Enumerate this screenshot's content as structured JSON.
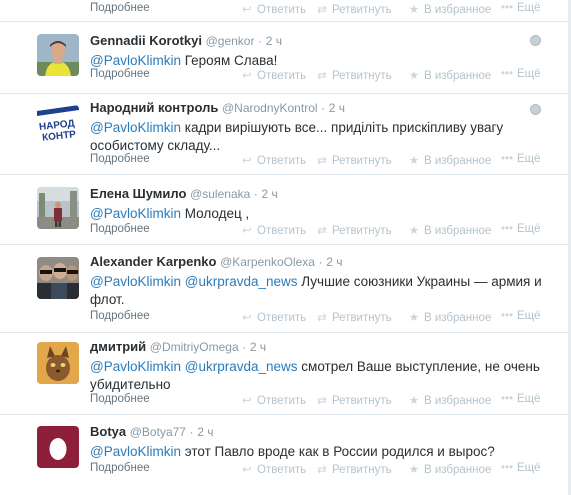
{
  "labels": {
    "details": "Подробнее",
    "reply": "Ответить",
    "retweet": "Ретвитнуть",
    "favorite": "В избранное",
    "more": "Ещё",
    "dot": "·"
  },
  "icons": {
    "reply": "reply-icon",
    "retweet": "retweet-icon",
    "favorite": "star-icon",
    "more": "more-icon",
    "globe": "globe-icon"
  },
  "colors": {
    "mention": "#2b7bb9",
    "muted": "#8899a6",
    "border": "#e1e8ed"
  },
  "tweets": [
    {
      "name": "Gennadii Korotkyi",
      "handle": "@genkor",
      "time": "2 ч",
      "mentions": [
        "@PavloKlimkin"
      ],
      "text": "Героям Слава!",
      "avatar": "man-in-yellow-shirt"
    },
    {
      "name": "Народний контроль",
      "handle": "@NarodnyKontrol",
      "time": "2 ч",
      "mentions": [
        "@PavloKlimkin"
      ],
      "text": "кадри вирішують все... приділіть прискіпливу увагу особистому складу...",
      "avatar": "logo-narodny-kontrol"
    },
    {
      "name": "Елена Шумило",
      "handle": "@sulenaka",
      "time": "2 ч",
      "mentions": [
        "@PavloKlimkin"
      ],
      "text": "Молодец ,",
      "avatar": "street-photo"
    },
    {
      "name": "Alexander Karpenko",
      "handle": "@KarpenkoOlexa",
      "time": "2 ч",
      "mentions": [
        "@PavloKlimkin",
        "@ukrpravda_news"
      ],
      "text": "Лучшие союзники Украины — армия и флот.",
      "avatar": "group-in-sunglasses"
    },
    {
      "name": "дмитрий",
      "handle": "@DmitriyOmega",
      "time": "2 ч",
      "mentions": [
        "@PavloKlimkin",
        "@ukrpravda_news"
      ],
      "text": "смотрел Ваше выступление, не очень убидительно",
      "avatar": "cat-photo"
    },
    {
      "name": "Botya",
      "handle": "@Botya77",
      "time": "2 ч",
      "mentions": [
        "@PavloKlimkin"
      ],
      "text": "этот Павло вроде как в России родился и вырос?",
      "avatar": "default-egg"
    }
  ]
}
